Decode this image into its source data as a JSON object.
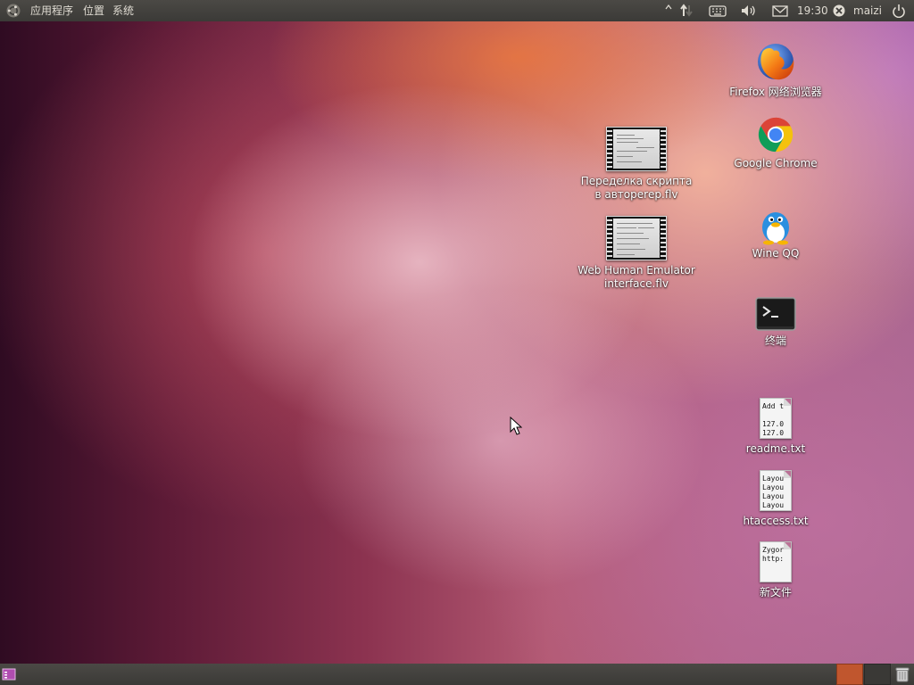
{
  "top_panel": {
    "menus": [
      "应用程序",
      "位置",
      "系统"
    ],
    "clock": "19:30",
    "user": "maizi"
  },
  "desktop": {
    "icons": [
      {
        "label": "Firefox 网络浏览器",
        "icon": "firefox-icon"
      },
      {
        "label": "Google Chrome",
        "icon": "chrome-icon"
      },
      {
        "label": "Wine QQ",
        "icon": "qq-penguin-icon"
      },
      {
        "label": "终端",
        "icon": "terminal-icon"
      },
      {
        "label": "readme.txt",
        "icon": "text-file-icon",
        "preview": "Add t\n\n127.0\n127.0"
      },
      {
        "label": "htaccess.txt",
        "icon": "text-file-icon",
        "preview": "Layou\nLayou\nLayou\nLayou"
      },
      {
        "label": "新文件",
        "icon": "text-file-icon",
        "preview": "Zygor\nhttp:"
      }
    ],
    "videos": [
      {
        "label": "Переделка скрипта в автореrер.flv",
        "icon": "video-thumbnail-icon"
      },
      {
        "label": "Web Human Emulator interface.flv",
        "icon": "video-thumbnail-icon"
      }
    ]
  },
  "colors": {
    "panel": "#3c3b37",
    "panel_text": "#dfdbd2",
    "workspace_active": "#c0562e"
  }
}
